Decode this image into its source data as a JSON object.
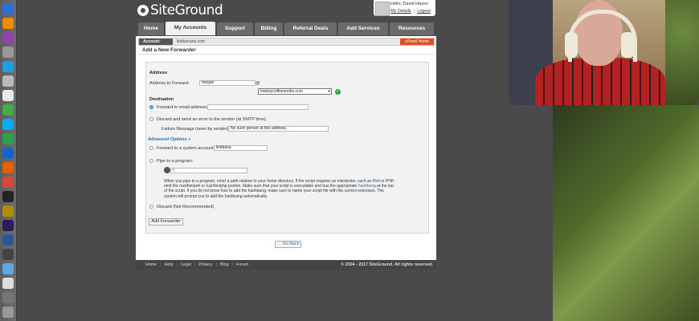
{
  "site": {
    "logo_text": "SiteGround",
    "user": {
      "greeting": "Hello, David Hayes",
      "my_details": "My Details",
      "logout": "Logout"
    },
    "nav_tabs": [
      {
        "label": "Home",
        "active": false
      },
      {
        "label": "My Accounts",
        "active": true
      },
      {
        "label": "Support",
        "active": false
      },
      {
        "label": "Billing",
        "active": false
      },
      {
        "label": "Referral Deals",
        "active": false
      },
      {
        "label": "Add Services",
        "active": false
      },
      {
        "label": "Resources",
        "active": false
      }
    ],
    "account_label": "Account:",
    "account_name": "linkbanana.com",
    "cpanel_button": "cPanel Home",
    "page_title": "Add a New Forwarder"
  },
  "form": {
    "address_heading": "Address",
    "address_to_forward_label": "Address to Forward:",
    "address_to_forward_value": "megan",
    "at_sign": "@",
    "domain_selected": "lowkeycoffeesnobs.com",
    "destination_heading": "Destination",
    "forward_email_label": "Forward to email address:",
    "forward_email_value": "",
    "discard_error_label": "Discard and send an error to the sender (at SMTP time).",
    "failure_message_label": "Failure Message (seen by sender):",
    "failure_message_value": "No such person at this address.",
    "advanced_options": "Advanced Options »",
    "system_account_label": "Forward to a system account:",
    "system_account_value": "linkbana",
    "pipe_label": "Pipe to a program:",
    "pipe_value": "/",
    "pipe_note_1": "When you pipe to a program, enter a path relative to your home directory. If the script requires an interpreter, such as Perl or PHP,",
    "pipe_note_2": "omit the /usr/bin/perl or /usr/bin/php portion. Make sure that your script is executable and has the appropriate",
    "pipe_note_link": "hashbang",
    "pipe_note_2b": "at the top",
    "pipe_note_3": "of the script. If you do not know how to add the hashbang, make sure to name your script file with the correct extension. The",
    "pipe_note_4": "system will prompt you to add the hashbang automatically.",
    "discard_label": "Discard (Not Recommended)",
    "submit_button": "Add Forwarder",
    "go_back": "← Go Back"
  },
  "footer": {
    "links": [
      "Home",
      "Help",
      "Legal",
      "Privacy",
      "Blog",
      "Forum"
    ],
    "copyright": "© 2004 - 2017 SiteGround. All rights reserved."
  },
  "dock_icons": [
    "finder-icon",
    "vlc-icon",
    "app-icon",
    "app-icon",
    "terminal-icon",
    "messages-icon",
    "slack-icon",
    "skype-icon",
    "app-icon",
    "app-icon",
    "firefox-icon",
    "chrome-icon",
    "terminal-icon",
    "app-icon",
    "photoshop-icon",
    "word-icon",
    "folder-icon",
    "app-icon",
    "app-icon",
    "app-icon"
  ],
  "colors": {
    "nav_bg": "#6a6a6a",
    "accent_orange": "#e64d1d",
    "link_blue": "#1f6fb2",
    "ok_green": "#28a745"
  }
}
